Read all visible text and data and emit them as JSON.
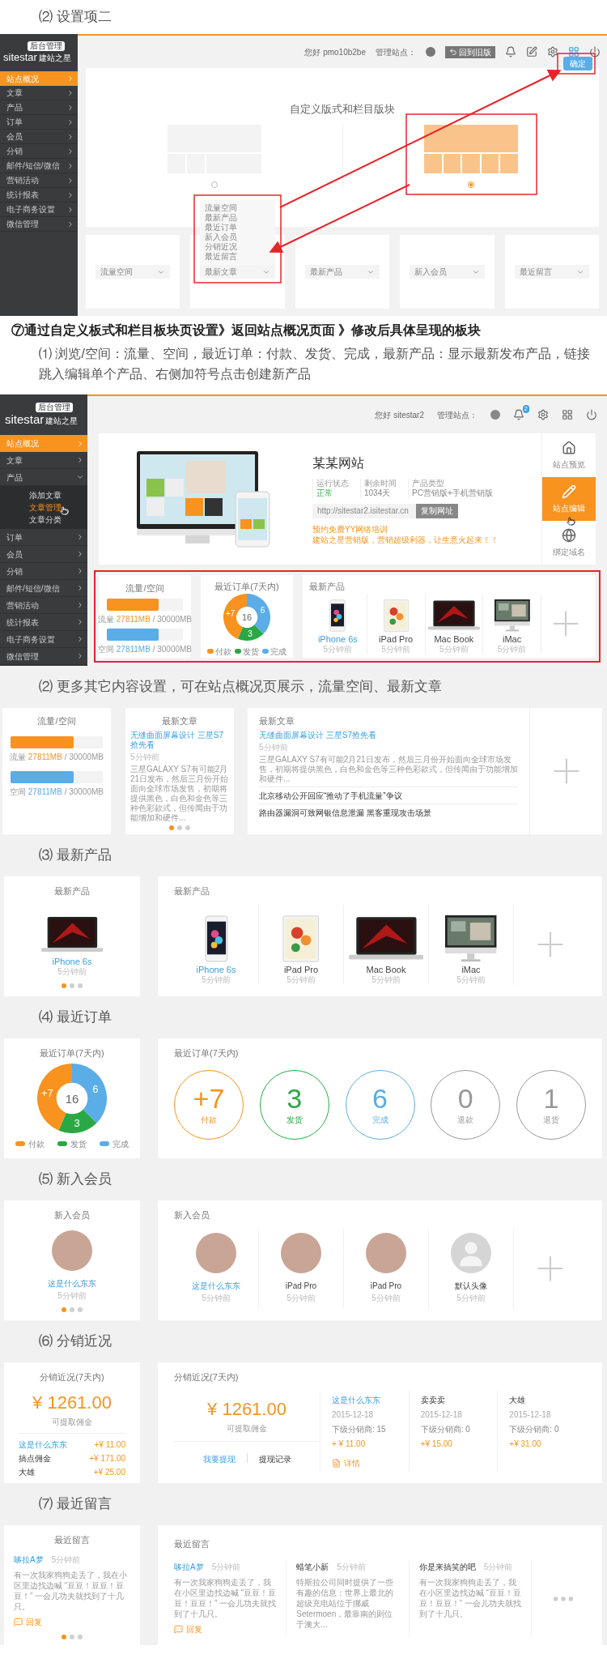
{
  "intro": {
    "title": "⑵ 设置项二"
  },
  "editor_screenshot": {
    "logo": {
      "badge": "后台管理",
      "name": "sitestar",
      "tagline": "建站之星"
    },
    "sidebar": [
      {
        "label": "站点概况",
        "selected": true,
        "expanded": false
      },
      {
        "label": "文章",
        "selected": false,
        "expanded": false
      },
      {
        "label": "产品",
        "selected": false,
        "expanded": false
      },
      {
        "label": "订单",
        "selected": false,
        "expanded": false
      },
      {
        "label": "会员",
        "selected": false,
        "expanded": false
      },
      {
        "label": "分销",
        "selected": false,
        "expanded": false
      },
      {
        "label": "邮件/短信/微信",
        "selected": false,
        "expanded": false
      },
      {
        "label": "营销活动",
        "selected": false,
        "expanded": false
      },
      {
        "label": "统计报表",
        "selected": false,
        "expanded": false
      },
      {
        "label": "电子商务设置",
        "selected": false,
        "expanded": false
      },
      {
        "label": "微信管理",
        "selected": false,
        "expanded": false
      }
    ],
    "topbar": {
      "greeting": "您好 pmo10b2be",
      "manage_label": "管理站点：",
      "old_version_button": "回到旧版",
      "layout_editing": true,
      "confirm_button": "确定"
    },
    "panel": {
      "title": "自定义版式和栏目版块",
      "layouts": [
        {
          "selected": false
        },
        {
          "selected": true
        }
      ]
    },
    "block_selects": [
      {
        "value": "流量空间"
      },
      {
        "value": "最新文章",
        "options": [
          "流量空间",
          "最新产品",
          "最近订单",
          "新入会员",
          "分销近况",
          "最近留言"
        ]
      },
      {
        "value": "最新产品"
      },
      {
        "value": "新入会员"
      },
      {
        "value": "最近留言"
      }
    ]
  },
  "step7": {
    "title": "⑦通过自定义板式和栏目板块页设置》返回站点概况页面 》修改后具体呈现的板块",
    "note": "⑴ 浏览/空间：流量、空间，最近订单：付款、发货、完成，最新产品：显示最新发布产品，链接跳入编辑单个产品、右侧加符号点击创建新产品"
  },
  "overview_screenshot": {
    "logo": {
      "badge": "后台管理",
      "name": "sitestar",
      "tagline": "建站之星"
    },
    "sidebar": [
      {
        "label": "站点概况",
        "selected": true,
        "expanded": false
      },
      {
        "label": "文章",
        "selected": false,
        "expanded": false
      },
      {
        "label": "产品",
        "selected": false,
        "expanded": true,
        "children": [
          {
            "label": "添加文章",
            "selected": false
          },
          {
            "label": "文章管理",
            "selected": true
          },
          {
            "label": "文章分类",
            "selected": false
          }
        ]
      },
      {
        "label": "订单",
        "selected": false,
        "expanded": false
      },
      {
        "label": "会员",
        "selected": false,
        "expanded": false
      },
      {
        "label": "分销",
        "selected": false,
        "expanded": false
      },
      {
        "label": "邮件/短信/微信",
        "selected": false,
        "expanded": false
      },
      {
        "label": "营销活动",
        "selected": false,
        "expanded": false
      },
      {
        "label": "统计报表",
        "selected": false,
        "expanded": false
      },
      {
        "label": "电子商务设置",
        "selected": false,
        "expanded": false
      },
      {
        "label": "微信管理",
        "selected": false,
        "expanded": false
      }
    ],
    "topbar": {
      "greeting": "您好 sitestar2",
      "manage_label": "管理站点：",
      "notification_count": "2"
    },
    "site": {
      "name": "某某网站",
      "stats": [
        {
          "label": "运行状态",
          "value": "正常",
          "kind": "status"
        },
        {
          "label": "剩余时间",
          "value": "1034天",
          "kind": "plain"
        },
        {
          "label": "产品类型",
          "value": "PC营销版+手机营销版",
          "kind": "plain"
        }
      ],
      "url": "http://sitestar2.isitestar.cn",
      "copy_button": "复制网址",
      "promos": [
        "预约免费YY网络培训",
        "建站之星营销版，营销超级利器，让生意火起来！！"
      ]
    },
    "actions": [
      {
        "label": "站点预览",
        "selected": false
      },
      {
        "label": "站点编辑",
        "selected": true
      },
      {
        "label": "绑定域名",
        "selected": false
      }
    ],
    "blocks": {
      "traffic": {
        "title": "流量/空间",
        "meters": [
          {
            "label": "流量",
            "used": "27811MB",
            "total": "/ 30000MB",
            "level": 0.68,
            "color": "#f7931e"
          },
          {
            "label": "空间",
            "used": "27811MB",
            "total": "/ 30000MB",
            "level": 0.68,
            "color": "#5aade6"
          }
        ]
      },
      "orders": {
        "title": "最近订单(7天内)",
        "chart_data": {
          "type": "donut",
          "categories": [
            "付款",
            "发货",
            "完成"
          ],
          "values": [
            43.75,
            18.75,
            37.5
          ]
        },
        "slice_labels": [
          "+7",
          "3",
          "6"
        ],
        "center_label": "16",
        "legend": [
          {
            "color": "#f7931e"
          },
          {
            "color": "#2aa845"
          },
          {
            "color": "#5aade6"
          }
        ]
      },
      "products": {
        "title": "最新产品",
        "items": [
          {
            "name": "iPhone 6s",
            "time": "5分钟前",
            "kind": "phone",
            "highlighted": true
          },
          {
            "name": "iPad Pro",
            "time": "5分钟前",
            "kind": "tablet",
            "highlighted": false
          },
          {
            "name": "Mac Book",
            "time": "5分钟前",
            "kind": "laptop",
            "highlighted": false
          },
          {
            "name": "iMac",
            "time": "5分钟前",
            "kind": "desktop",
            "highlighted": false
          }
        ]
      }
    }
  },
  "more_blocks": {
    "heading": "⑵ 更多其它内容设置，可在站点概况页展示，流量空间、最新文章",
    "traffic": {
      "title": "流量/空间",
      "meters": [
        {
          "label": "流量",
          "used": "27811MB",
          "total": "/ 30000MB",
          "level": 0.68,
          "color": "#f7931e"
        },
        {
          "label": "空间",
          "used": "27811MB",
          "total": "/ 30000MB",
          "level": 0.68,
          "color": "#5aade6"
        }
      ]
    },
    "article_single": {
      "title": "最新文章",
      "headline": "无缝曲面屏幕设计 三星S7抢先看",
      "time": "5分钟前",
      "summary": "三星GALAXY S7有可能2月21日发布，然后三月份开始面向全球市场发售，初期将提供黑色，白色和金色等三种色彩款式，但传闻由于功能增加和硬件...",
      "pager": [
        {
          "selected": true
        },
        {
          "selected": false
        },
        {
          "selected": false
        }
      ]
    },
    "article_list": {
      "title": "最新文章",
      "headline": "无缝曲面屏幕设计 三星S7抢先看",
      "time": "5分钟前",
      "summary": "三星GALAXY S7有可能2月21日发布，然后三月份开始面向全球市场发售，初期将提供黑色，白色和金色等三种色彩款式，但传闻由于功能增加和硬件...",
      "items": [
        "北京移动公开回应“推动了手机流量”争议",
        "路由器漏洞可致网银信息泄漏 黑客重现攻击场景"
      ]
    }
  },
  "latest_products": {
    "heading": "⑶ 最新产品",
    "single": {
      "title": "最新产品",
      "product": {
        "name": "iPhone 6s",
        "time": "5分钟前",
        "kind": "laptop",
        "highlighted": true
      },
      "pager": [
        {
          "selected": true
        },
        {
          "selected": false
        },
        {
          "selected": false
        }
      ]
    },
    "list": {
      "title": "最新产品",
      "items": [
        {
          "name": "iPhone 6s",
          "time": "5分钟前",
          "kind": "phone",
          "highlighted": true
        },
        {
          "name": "iPad Pro",
          "time": "5分钟前",
          "kind": "tablet",
          "highlighted": false
        },
        {
          "name": "Mac Book",
          "time": "5分钟前",
          "kind": "laptop",
          "highlighted": false
        },
        {
          "name": "iMac",
          "time": "5分钟前",
          "kind": "desktop",
          "highlighted": false
        }
      ]
    }
  },
  "recent_orders": {
    "heading": "⑷ 最近订单",
    "donut": {
      "title": "最近订单(7天内)",
      "chart_data": {
        "type": "donut",
        "categories": [
          "付款",
          "发货",
          "完成"
        ],
        "values": [
          43.75,
          18.75,
          37.5
        ]
      },
      "slice_labels": [
        "+7",
        "3",
        "6"
      ],
      "center_label": "16",
      "legend": [
        {
          "color": "#f7931e"
        },
        {
          "color": "#2aa845"
        },
        {
          "color": "#5aade6"
        }
      ]
    },
    "counters": {
      "title": "最近订单(7天内)",
      "items": [
        {
          "value": "+7",
          "label": "付款",
          "color": "#f7931e"
        },
        {
          "value": "3",
          "label": "发货",
          "color": "#2aa845"
        },
        {
          "value": "6",
          "label": "完成",
          "color": "#5aade6"
        },
        {
          "value": "0",
          "label": "退款",
          "color": "#999999"
        },
        {
          "value": "1",
          "label": "退货",
          "color": "#999999"
        }
      ]
    }
  },
  "new_members": {
    "heading": "⑸ 新入会员",
    "single": {
      "title": "新入会员",
      "member": {
        "name": "这是什么东东",
        "time": "5分钟前",
        "kind": "photo",
        "highlighted": true
      },
      "pager": [
        {
          "selected": true
        },
        {
          "selected": false
        },
        {
          "selected": false
        }
      ]
    },
    "list": {
      "title": "新入会员",
      "items": [
        {
          "name": "这是什么东东",
          "time": "5分钟前",
          "kind": "photo",
          "highlighted": true
        },
        {
          "name": "iPad Pro",
          "time": "5分钟前",
          "kind": "photo",
          "highlighted": false
        },
        {
          "name": "iPad Pro",
          "time": "5分钟前",
          "kind": "photo",
          "highlighted": false
        },
        {
          "name": "默认头像",
          "time": "5分钟前",
          "kind": "default",
          "highlighted": false
        }
      ]
    }
  },
  "distribution": {
    "heading": "⑹ 分销近况",
    "summary": {
      "title": "分销近况(7天内)",
      "amount": "¥ 1261.00",
      "amount_label": "可提取佣金",
      "rows": [
        {
          "name": "这是什么东东",
          "amount": "+¥ 11.00",
          "highlighted": true
        },
        {
          "name": "搞点佣金",
          "amount": "+¥ 171.00",
          "highlighted": false
        },
        {
          "name": "大雄",
          "amount": "+¥ 25.00",
          "highlighted": false
        }
      ]
    },
    "detail": {
      "title": "分销近况(7天内)",
      "amount": "¥ 1261.00",
      "amount_label": "可提取佣金",
      "withdraw_link": "我要提现",
      "history_link": "提现记录",
      "distributors": [
        {
          "name": "这是什么东东",
          "date": "2015-12-18",
          "subordinates": "下级分销商: 15",
          "amount": "+ ¥ 11.00",
          "highlighted": true,
          "detail_link": "详情"
        },
        {
          "name": "卖卖卖",
          "date": "2015-12-18",
          "subordinates": "下级分销商: 0",
          "amount": "+¥ 15.00",
          "highlighted": false
        },
        {
          "name": "大雄",
          "date": "2015-12-18",
          "subordinates": "下级分销商: 0",
          "amount": "+¥ 31.00",
          "highlighted": false
        }
      ]
    }
  },
  "recent_messages": {
    "heading": "⑺ 最近留言",
    "single": {
      "title": "最近留言",
      "message": {
        "author": "哆拉A梦",
        "time": "5分钟前",
        "text": "有一次我家狗狗走丢了，我在小区里边找边喊 “豆豆！豆豆！豆豆！” 一会儿功夫就找到了十几只。",
        "highlighted": true,
        "reply": "回复"
      },
      "pager": [
        {
          "selected": true
        },
        {
          "selected": false
        },
        {
          "selected": false
        }
      ]
    },
    "list": {
      "title": "最近留言",
      "items": [
        {
          "author": "哆拉A梦",
          "time": "5分钟前",
          "text": "有一次我家狗狗走丢了，我在小区里边找边喊 “豆豆！豆豆！豆豆！” 一会儿功夫就找到了十几只。",
          "highlighted": true,
          "reply": "回复"
        },
        {
          "author": "蜡笔小新",
          "time": "5分钟前",
          "text": "特斯拉公司同时提供了一些有趣的信息：世界上最北的超级充电站位于挪威Setermoen，最靠南的则位于澳大...",
          "highlighted": false
        },
        {
          "author": "你是来搞笑的吧",
          "time": "5分钟前",
          "text": "有一次我家狗狗走丢了，我在小区里边找边喊 “豆豆！豆豆！豆豆！” 一会儿功夫就找到了十几只。",
          "highlighted": false
        }
      ]
    }
  }
}
